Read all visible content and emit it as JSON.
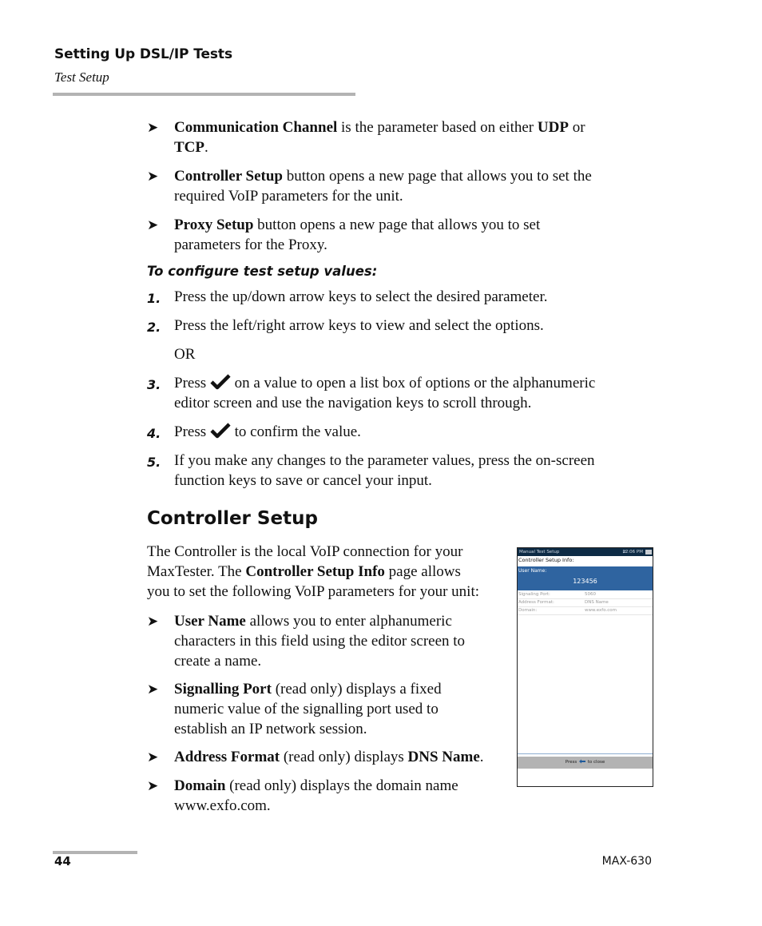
{
  "header": {
    "chapter_title": "Setting Up DSL/IP Tests",
    "section_subtitle": "Test Setup"
  },
  "top_bullets": [
    {
      "bold": "Communication Channel",
      "text1": " is the parameter based on either ",
      "bold2": "UDP",
      "text2": " or",
      "bold3": "TCP",
      "text3": "."
    },
    {
      "bold": "Controller Setup",
      "line1": " button opens a new page that allows you to set the",
      "line2": "required VoIP parameters for the unit."
    },
    {
      "bold": "Proxy Setup",
      "line1": " button opens a new page that allows you to set",
      "line2": "parameters for the Proxy."
    }
  ],
  "procedure": {
    "heading": "To configure test setup values:",
    "steps": [
      {
        "num": "1.",
        "line1": "Press the up/down arrow keys to select the desired parameter."
      },
      {
        "num": "2.",
        "line1": "Press the left/right arrow keys to view and select the options."
      },
      {
        "or": "OR"
      },
      {
        "num": "3.",
        "before_icon": "Press ",
        "icon": "checkmark-icon",
        "line1": " on a value to open a list box of options or the alphanumeric",
        "line2": "editor screen and use the navigation keys to scroll through."
      },
      {
        "num": "4.",
        "before_icon": "Press ",
        "icon": "checkmark-icon",
        "line1": " to confirm the value."
      },
      {
        "num": "5.",
        "line1": "If you make any changes to the parameter values, press the on-screen",
        "line2": "function keys to save or cancel your input."
      }
    ]
  },
  "controller_section": {
    "heading": "Controller Setup",
    "intro_line1": "The Controller is the local VoIP connection for your",
    "intro_line2_pre": "MaxTester. The ",
    "intro_line2_bold": "Controller Setup Info",
    "intro_line2_post": " page allows",
    "intro_line3": "you to set the following VoIP parameters for your unit:",
    "bullets": [
      {
        "bold": "User Name",
        "line1": " allows you to enter alphanumeric",
        "line2": "characters in this field using the editor screen to",
        "line3": "create a name."
      },
      {
        "bold": "Signalling Port",
        "line1": " (read only) displays a fixed",
        "line2": "numeric value of the signalling port used to",
        "line3": "establish an IP network session."
      },
      {
        "bold": "Address Format",
        "line1": " (read only) displays ",
        "bold2": "DNS Name",
        "end": "."
      },
      {
        "bold": "Domain",
        "line1": " (read only) displays the domain name",
        "line2": "www.exfo.com."
      }
    ]
  },
  "device_screen": {
    "title": "Manual Test Setup",
    "clock": "12:06 PM",
    "net_icon": "network-transfer-icon",
    "battery_icon": "battery-icon",
    "heading": "Controller Setup Info:",
    "user_name_label": "User Name:",
    "user_name_value": "123456",
    "rows": [
      {
        "label": "Signaling Port:",
        "value": "5060"
      },
      {
        "label": "Address Format:",
        "value": "DNS Name"
      },
      {
        "label": "Domain:",
        "value": "www.exfo.com"
      }
    ],
    "footer_pre": "Press ",
    "footer_icon": "back-arrow-icon",
    "footer_post": " to close",
    "colors": {
      "titlebar": "#0d2b45",
      "selected": "#2f64a0",
      "footer": "#b3b3b3"
    }
  },
  "footer": {
    "page_number": "44",
    "product": "MAX-630"
  }
}
